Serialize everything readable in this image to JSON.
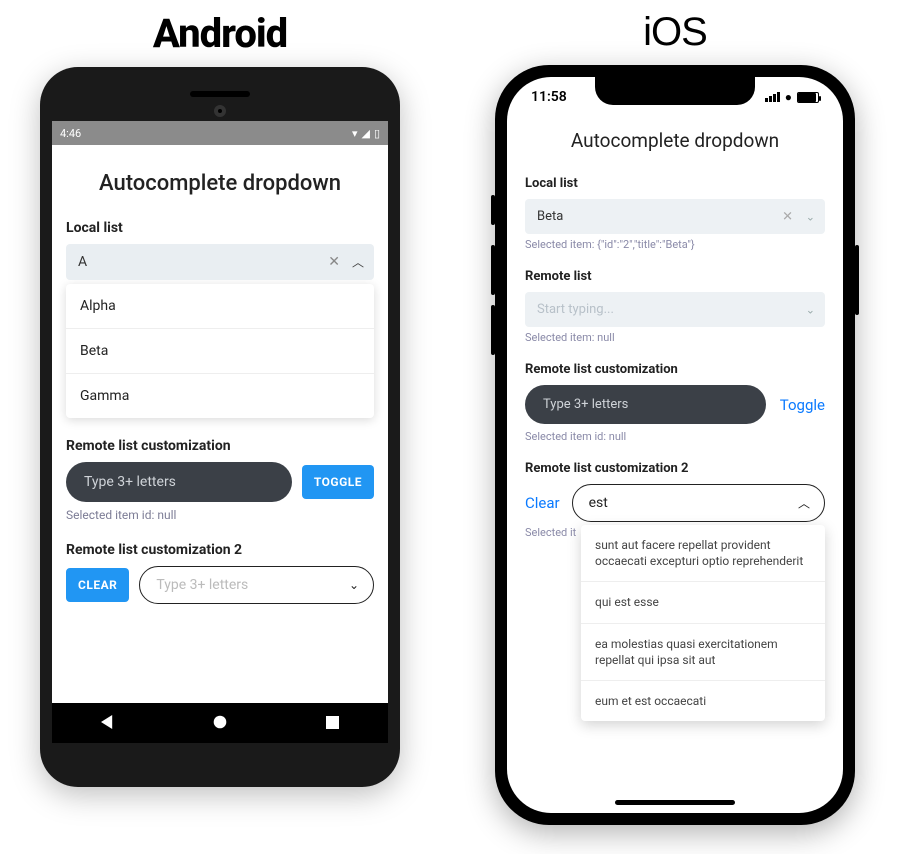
{
  "labels": {
    "android": "Android",
    "ios": "iOS"
  },
  "android": {
    "status": {
      "time": "4:46"
    },
    "title": "Autocomplete dropdown",
    "local": {
      "label": "Local list",
      "value": "A",
      "options": [
        "Alpha",
        "Beta",
        "Gamma"
      ]
    },
    "remote_custom": {
      "label": "Remote list customization",
      "placeholder": "Type 3+ letters",
      "toggle": "TOGGLE",
      "helper": "Selected item id: null"
    },
    "remote_custom2": {
      "label": "Remote list customization 2",
      "clear": "CLEAR",
      "placeholder": "Type 3+ letters"
    }
  },
  "ios": {
    "status": {
      "time": "11:58"
    },
    "title": "Autocomplete dropdown",
    "local": {
      "label": "Local list",
      "value": "Beta",
      "helper": "Selected item: {\"id\":\"2\",\"title\":\"Beta\"}"
    },
    "remote": {
      "label": "Remote list",
      "placeholder": "Start typing...",
      "helper": "Selected item: null"
    },
    "remote_custom": {
      "label": "Remote list customization",
      "placeholder": "Type 3+ letters",
      "toggle": "Toggle",
      "helper": "Selected item id: null"
    },
    "remote_custom2": {
      "label": "Remote list customization 2",
      "clear": "Clear",
      "value": "est",
      "helper_prefix": "Selected it",
      "options": [
        "sunt aut facere repellat provident occaecati excepturi optio reprehenderit",
        "qui est esse",
        "ea molestias quasi exercitationem repellat qui ipsa sit aut",
        "eum et est occaecati"
      ]
    }
  }
}
